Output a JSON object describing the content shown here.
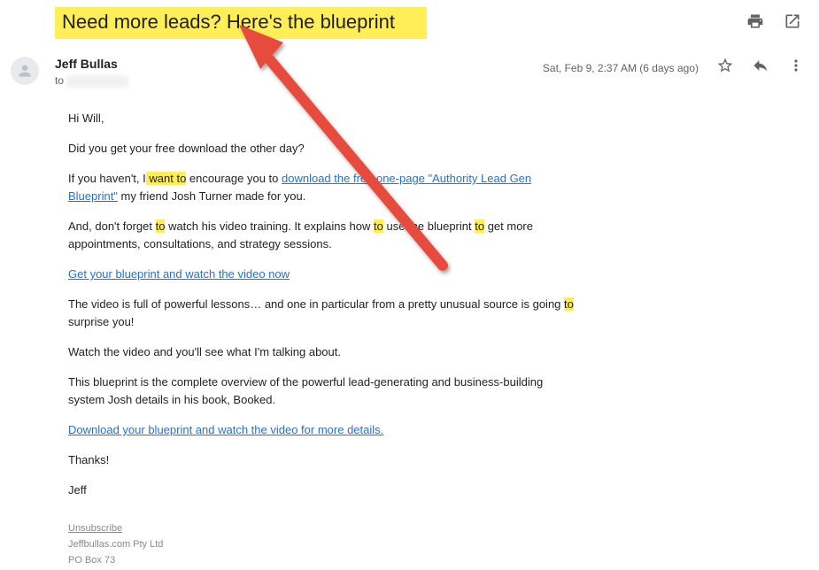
{
  "subject": "Need more leads? Here's the blueprint",
  "sender": {
    "name": "Jeff Bullas",
    "to_label": "to ",
    "date": "Sat, Feb 9, 2:37 AM (6 days ago)"
  },
  "body": {
    "greeting": "Hi Will,",
    "p1": "Did you get your free download the other day?",
    "p2a": "If you haven't, I",
    "p2_hl1": " want ",
    "p2_hl2": "to",
    "p2b": " encourage you to ",
    "p2_link": "download the free one-page \"Authority Lead Gen Blueprint\"",
    "p2c": " my friend Josh Turner made for you.",
    "p3a": "And, don't forget ",
    "p3_hl1": "to",
    "p3b": " watch his video training. It explains how ",
    "p3_hl2": "to",
    "p3c": " use the blueprint ",
    "p3_hl3": "to",
    "p3d": " get more appointments, consultations, and strategy sessions.",
    "p4_link": "Get your blueprint and watch the video now",
    "p5a": "The video is full of powerful lessons… and one in particular from a pretty unusual source is going ",
    "p5_hl": "to",
    "p5b": " surprise you!",
    "p6": "Watch the video and you'll see what I'm talking about.",
    "p7": "This blueprint is the complete overview of the powerful lead-generating and business-building system Josh details in his book, Booked.",
    "p8_link": "Download your blueprint and watch the video for more details.",
    "thanks": "Thanks!",
    "signoff": "Jeff"
  },
  "footer": {
    "unsubscribe": "Unsubscribe",
    "company": "Jeffbullas.com Pty Ltd",
    "address": "PO Box 73"
  }
}
